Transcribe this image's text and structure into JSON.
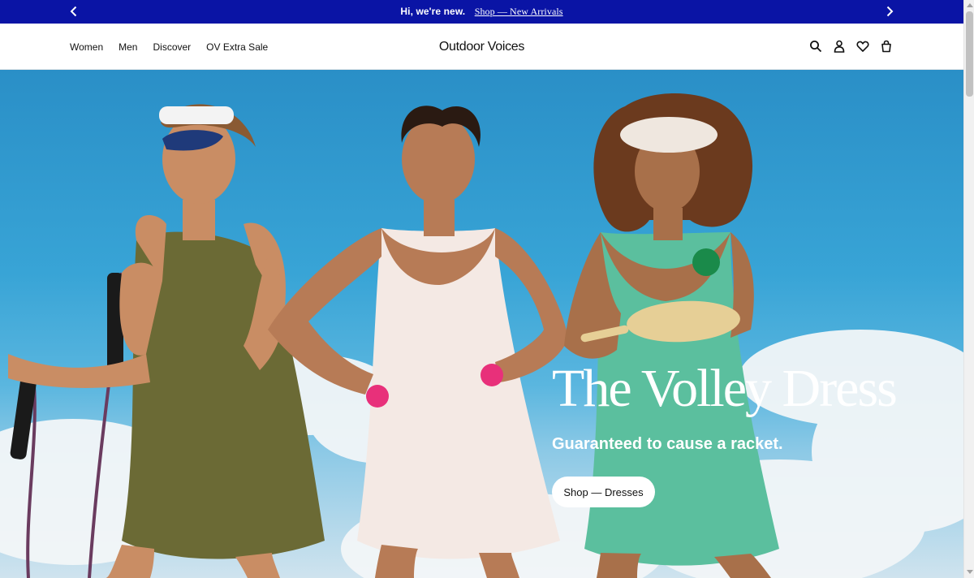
{
  "announcement": {
    "intro": "Hi, we're new.",
    "link_label": "Shop — New Arrivals",
    "bg_color": "#0a14a5",
    "prev_icon": "chevron-left-icon",
    "next_icon": "chevron-right-icon"
  },
  "header": {
    "nav": [
      {
        "label": "Women"
      },
      {
        "label": "Men"
      },
      {
        "label": "Discover"
      },
      {
        "label": "OV Extra Sale"
      }
    ],
    "brand": "Outdoor Voices",
    "icons": [
      "search-icon",
      "account-icon",
      "wishlist-icon",
      "bag-icon"
    ]
  },
  "hero": {
    "title": "The Volley Dress",
    "subtitle": "Guaranteed to cause a racket.",
    "cta_label": "Shop — Dresses"
  }
}
